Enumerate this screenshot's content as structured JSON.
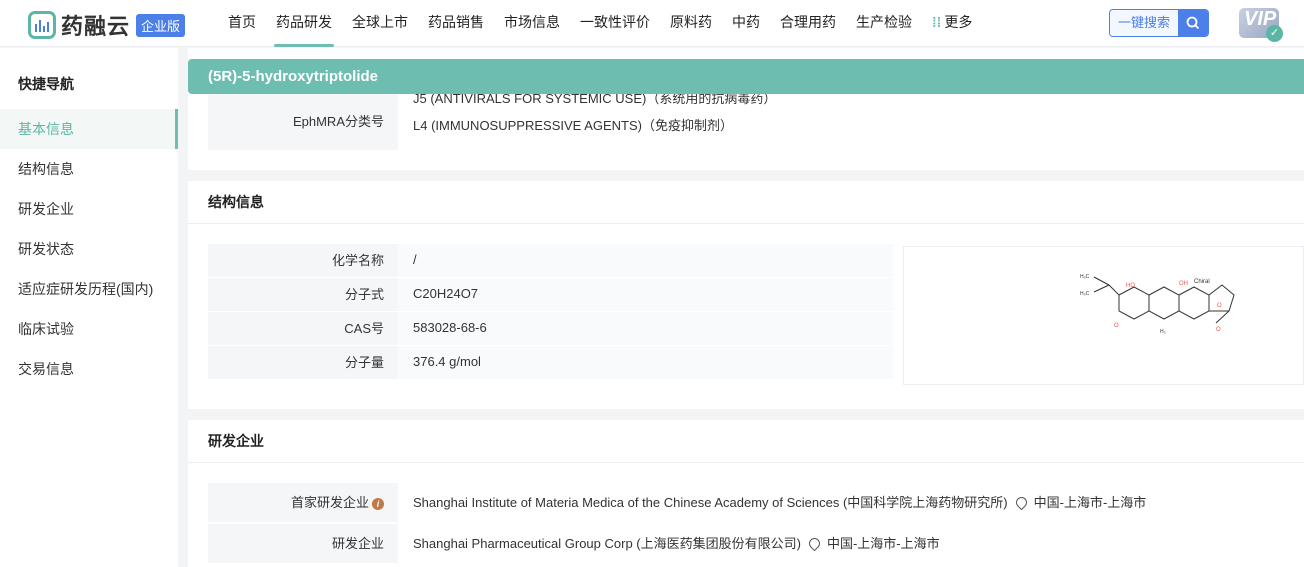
{
  "header": {
    "logo_text": "药融云",
    "edition_badge": "企业版",
    "nav": [
      {
        "label": "首页"
      },
      {
        "label": "药品研发",
        "active": true
      },
      {
        "label": "全球上市"
      },
      {
        "label": "药品销售"
      },
      {
        "label": "市场信息"
      },
      {
        "label": "一致性评价"
      },
      {
        "label": "原料药"
      },
      {
        "label": "中药"
      },
      {
        "label": "合理用药"
      },
      {
        "label": "生产检验"
      },
      {
        "label": "更多"
      }
    ],
    "search_label": "一键搜索",
    "vip_label": "VIP"
  },
  "sidebar": {
    "title": "快捷导航",
    "items": [
      {
        "label": "基本信息",
        "active": true
      },
      {
        "label": "结构信息"
      },
      {
        "label": "研发企业"
      },
      {
        "label": "研发状态"
      },
      {
        "label": "适应症研发历程(国内)"
      },
      {
        "label": "临床试验"
      },
      {
        "label": "交易信息"
      }
    ]
  },
  "drug_title": "(5R)-5-hydroxytriptolide",
  "basic": {
    "ephmra_label": "EphMRA分类号",
    "ephmra_values": [
      "J5 (ANTIVIRALS FOR SYSTEMIC USE)（系统用的抗病毒药）",
      "L4 (IMMUNOSUPPRESSIVE AGENTS)（免疫抑制剂）"
    ]
  },
  "structure": {
    "title": "结构信息",
    "rows": [
      {
        "label": "化学名称",
        "value": "/"
      },
      {
        "label": "分子式",
        "value": "C20H24O7"
      },
      {
        "label": "CAS号",
        "value": "583028-68-6"
      },
      {
        "label": "分子量",
        "value": "376.4 g/mol"
      }
    ],
    "image_label": "Chiral"
  },
  "companies": {
    "title": "研发企业",
    "rows": [
      {
        "label": "首家研发企业",
        "value": "Shanghai Institute of Materia Medica of the Chinese Academy of Sciences (中国科学院上海药物研究所)",
        "location": "中国-上海市-上海市"
      },
      {
        "label": "研发企业",
        "value": "Shanghai Pharmaceutical Group Corp (上海医药集团股份有限公司)",
        "location": "中国-上海市-上海市"
      }
    ]
  }
}
